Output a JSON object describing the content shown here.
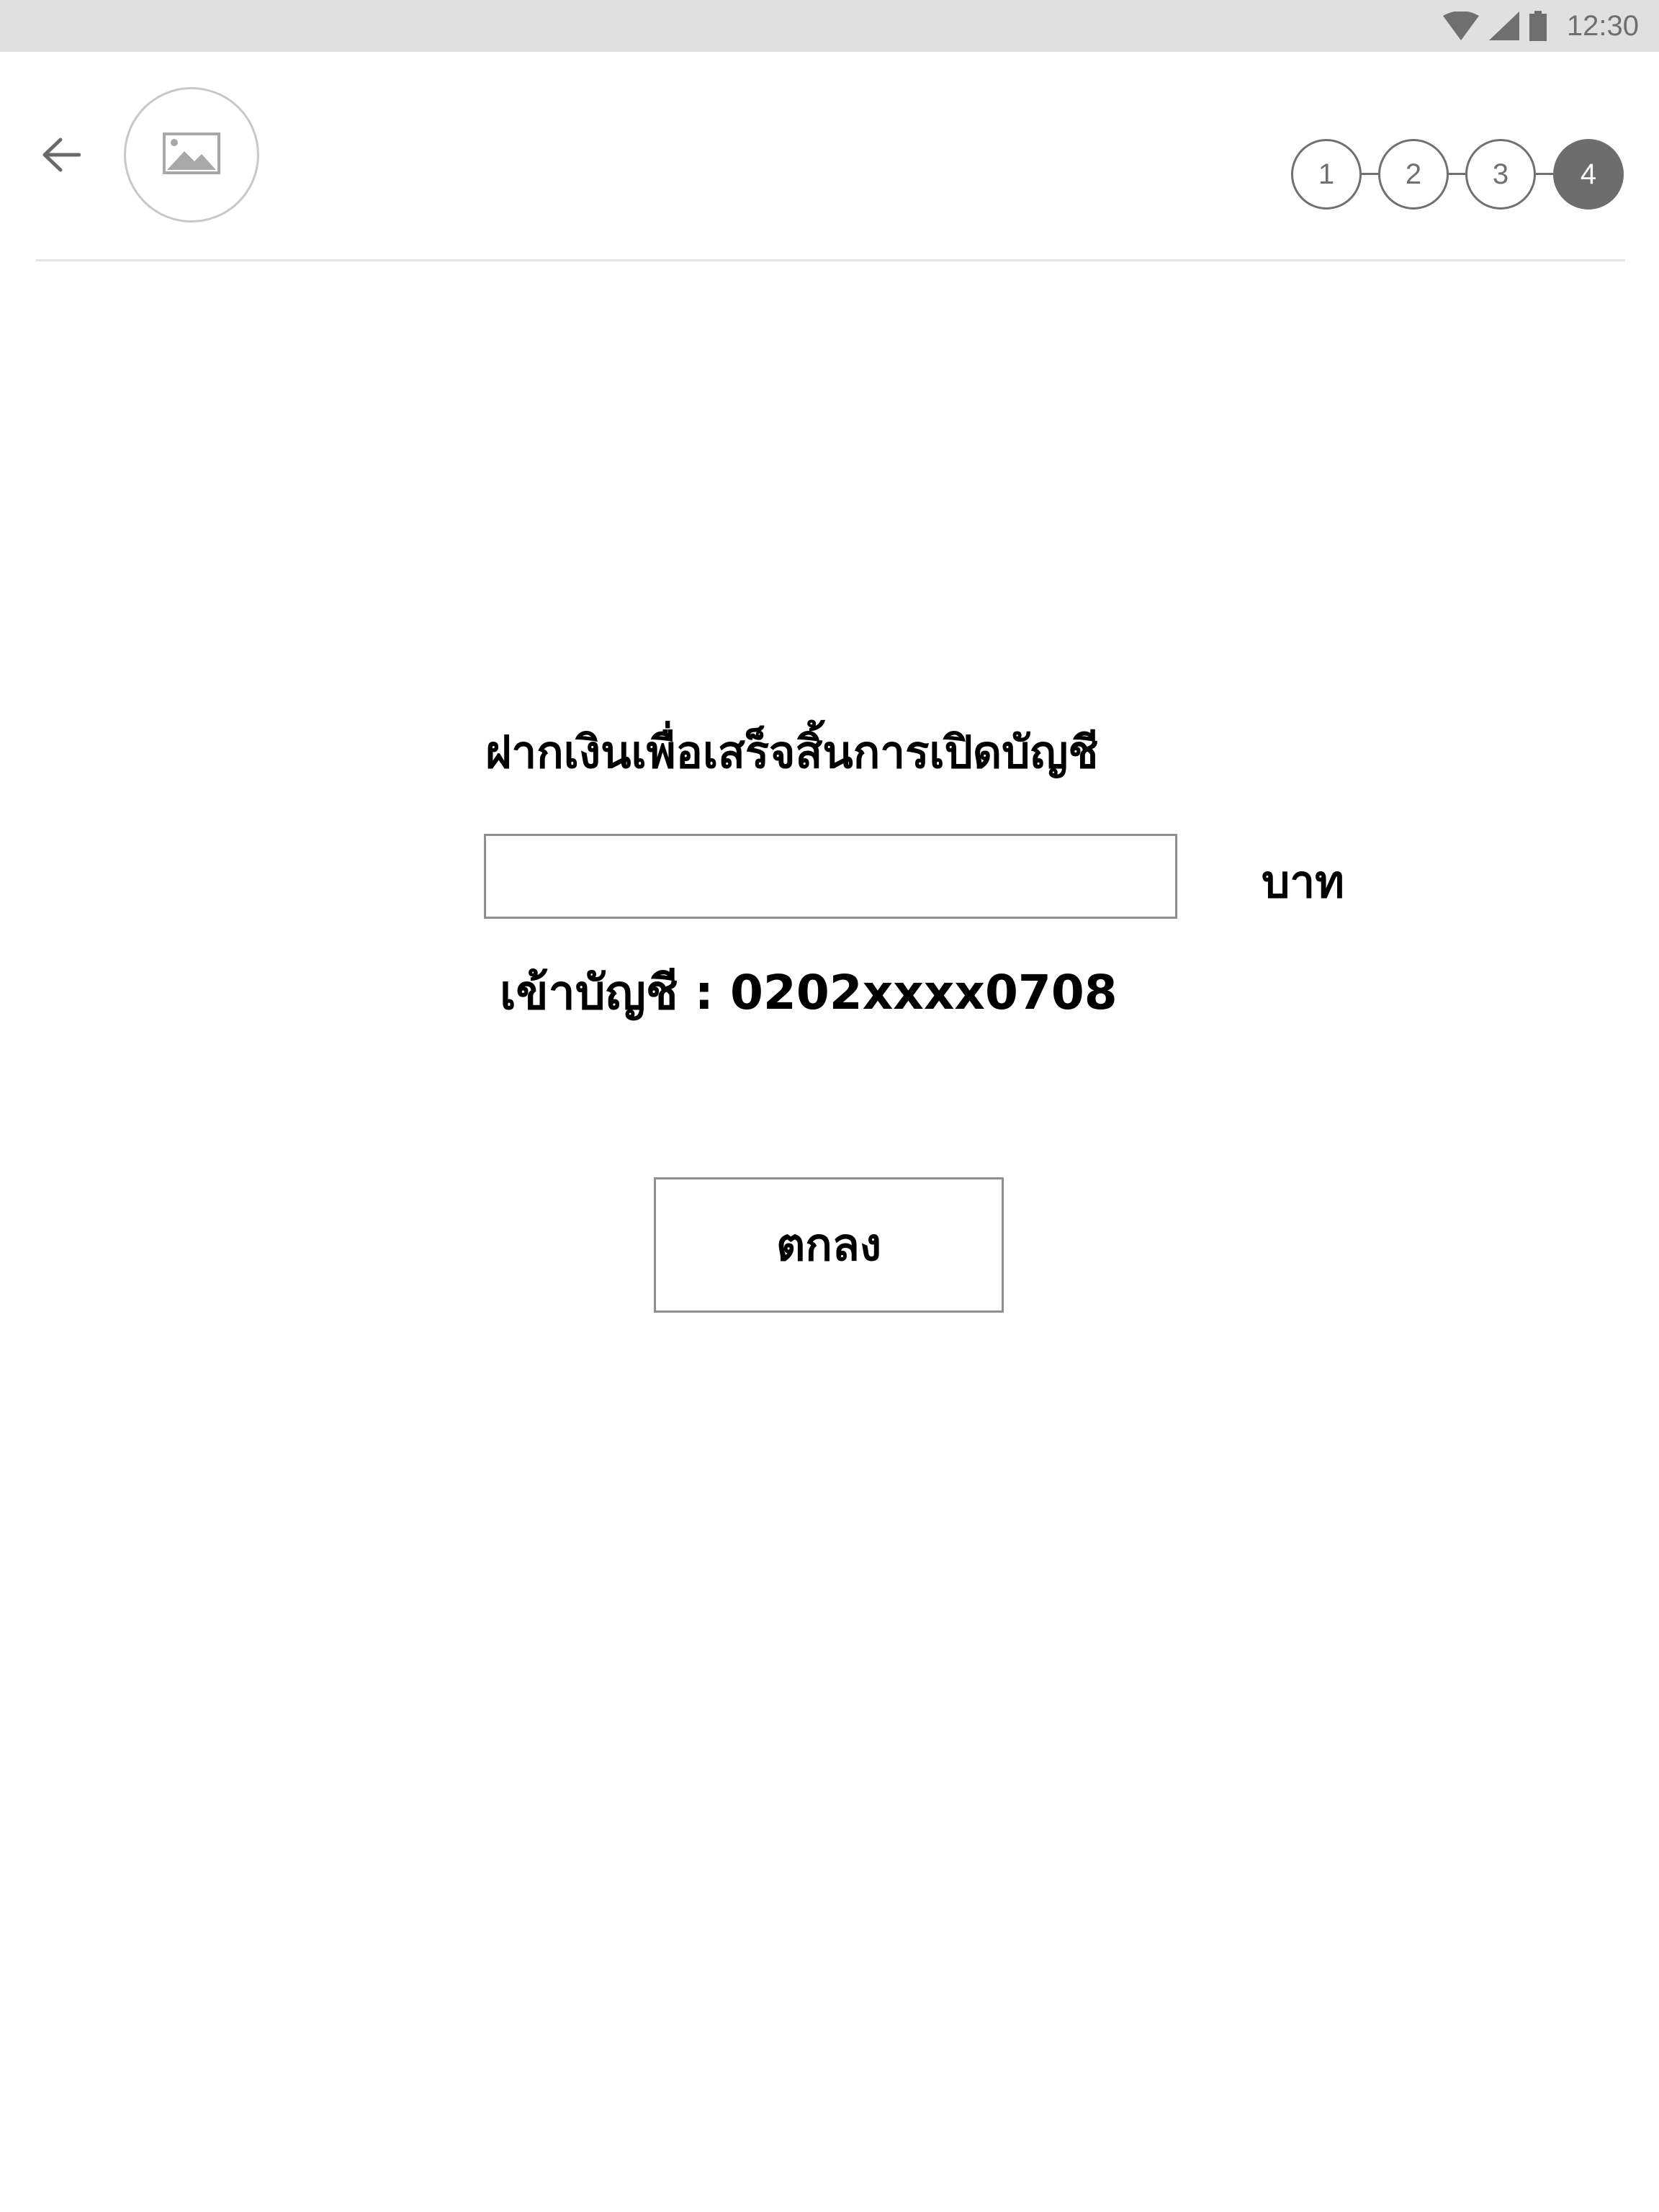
{
  "status_bar": {
    "time": "12:30",
    "icons": [
      "wifi-icon",
      "signal-icon",
      "battery-icon"
    ]
  },
  "header": {
    "back_icon": "arrow-left-icon",
    "logo_icon": "image-placeholder-icon",
    "steps": [
      "1",
      "2",
      "3",
      "4"
    ],
    "active_step": "4"
  },
  "main": {
    "title": "ฝากเงินเพื่อเสร็จสิ้นการเปิดบัญชี",
    "amount_input": {
      "value": "",
      "placeholder": ""
    },
    "currency": "บาท",
    "account_line": "เข้าบัญชี : 0202xxxx0708",
    "ok_label": "ตกลง"
  },
  "colors": {
    "status_bar_bg": "#e0e0e0",
    "icon_gray": "#6f6f6f",
    "active_step_bg": "#6d6d6d",
    "border_gray": "#8f8f8f"
  }
}
